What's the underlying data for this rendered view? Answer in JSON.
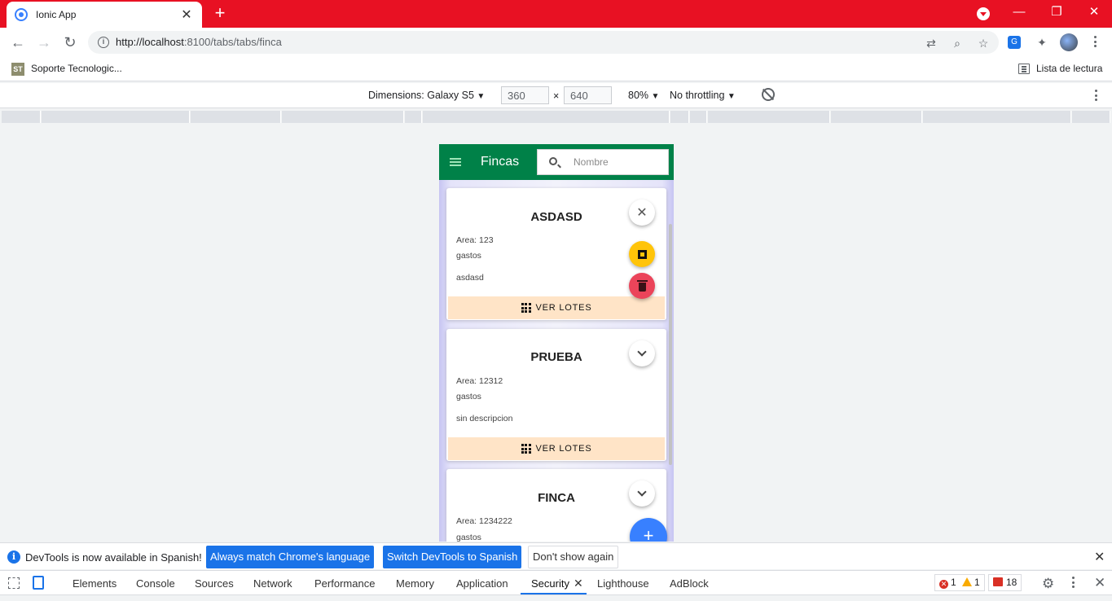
{
  "browser": {
    "tab_title": "Ionic App",
    "tab_close": "✕",
    "new_tab": "+",
    "controls": {
      "minimize": "—",
      "restore": "❐",
      "close": "✕"
    },
    "url_host": "http://localhost",
    "url_rest": ":8100/tabs/tabs/finca",
    "bookmark_label": "Soporte Tecnologic...",
    "bookmark_icon_text": "ST",
    "reading_list": "Lista de lectura"
  },
  "device_toolbar": {
    "dimensions_label": "Dimensions: Galaxy S5",
    "width": "360",
    "height": "640",
    "times": "×",
    "zoom": "80%",
    "throttling": "No throttling",
    "arrow": "▼"
  },
  "app": {
    "header_title": "Fincas",
    "search_placeholder": "Nombre",
    "fab_add": "+",
    "cards": [
      {
        "title": "ASDASD",
        "area": "Area: 123",
        "gastos": "gastos",
        "description": "asdasd",
        "button": "VER LOTES",
        "expanded": true,
        "close_symbol": "✕"
      },
      {
        "title": "PRUEBA",
        "area": "Area: 12312",
        "gastos": "gastos",
        "description": "sin descripcion",
        "button": "VER LOTES",
        "expanded": false
      },
      {
        "title": "FINCA",
        "area": "Area: 1234222",
        "gastos": "gastos",
        "expanded": false
      }
    ]
  },
  "notice": {
    "icon": "i",
    "text": "DevTools is now available in Spanish!",
    "btn_match": "Always match Chrome's language",
    "btn_switch": "Switch DevTools to Spanish",
    "btn_dismiss": "Don't show again",
    "close": "✕"
  },
  "devtools": {
    "tabs": [
      "Elements",
      "Console",
      "Sources",
      "Network",
      "Performance",
      "Memory",
      "Application",
      "Security",
      "Lighthouse",
      "AdBlock"
    ],
    "active_tab": "Security",
    "tab_close": "✕",
    "errors": "1",
    "warnings": "1",
    "issues": "18",
    "settings_icon": "⚙",
    "close": "✕"
  },
  "colors": {
    "titlebar": "#e81123",
    "app_header": "#008148",
    "fab_add": "#3880ff",
    "fab_edit": "#ffc409",
    "fab_delete": "#eb445a",
    "card_button_bg": "#ffe4c7",
    "devtools_accent": "#1a73e8"
  }
}
